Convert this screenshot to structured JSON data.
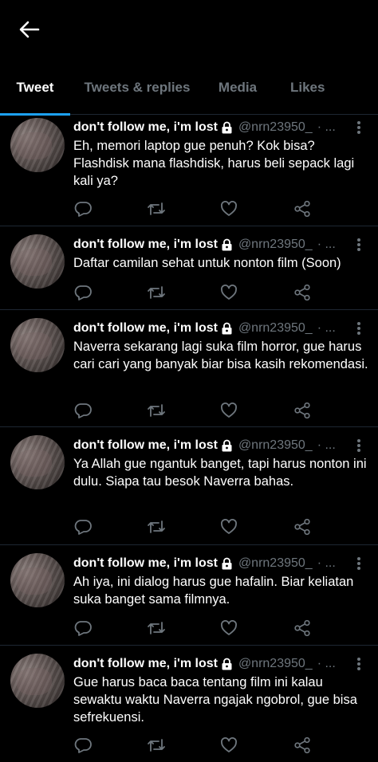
{
  "header": {
    "back_icon": "arrow-left-icon"
  },
  "tabs": [
    {
      "label": "Tweet",
      "active": true
    },
    {
      "label": "Tweets & replies",
      "active": false
    },
    {
      "label": "Media",
      "active": false
    },
    {
      "label": "Likes",
      "active": false
    }
  ],
  "colors": {
    "accent": "#1da1f2",
    "muted": "#6e767d",
    "background": "#000000",
    "divider": "#1e2732"
  },
  "tweets": [
    {
      "name": "don't follow me, i'm lost",
      "handle": "@nrn23950_",
      "meta": "· ...",
      "text": "Eh, memori laptop gue penuh? Kok bisa? Flashdisk mana flashdisk, harus beli sepack lagi kali ya?"
    },
    {
      "name": "don't follow me, i'm lost",
      "handle": "@nrn23950_",
      "meta": "· ...",
      "text": "Daftar camilan sehat untuk nonton film (Soon)"
    },
    {
      "name": "don't follow me, i'm lost",
      "handle": "@nrn23950_",
      "meta": "· ...",
      "text": "Naverra sekarang lagi suka film horror, gue harus cari cari yang banyak biar bisa kasih rekomendasi."
    },
    {
      "name": "don't follow me, i'm lost",
      "handle": "@nrn23950_",
      "meta": "· ...",
      "text": "Ya Allah gue ngantuk banget, tapi harus nonton ini dulu. Siapa tau besok Naverra bahas."
    },
    {
      "name": "don't follow me, i'm lost",
      "handle": "@nrn23950_",
      "meta": "· ...",
      "text": "Ah iya, ini dialog harus gue hafalin. Biar keliatan suka banget sama filmnya."
    },
    {
      "name": "don't follow me, i'm lost",
      "handle": "@nrn23950_",
      "meta": "· ...",
      "text": "Gue harus baca baca tentang film ini kalau sewaktu waktu Naverra ngajak ngobrol, gue bisa sefrekuensi."
    }
  ]
}
